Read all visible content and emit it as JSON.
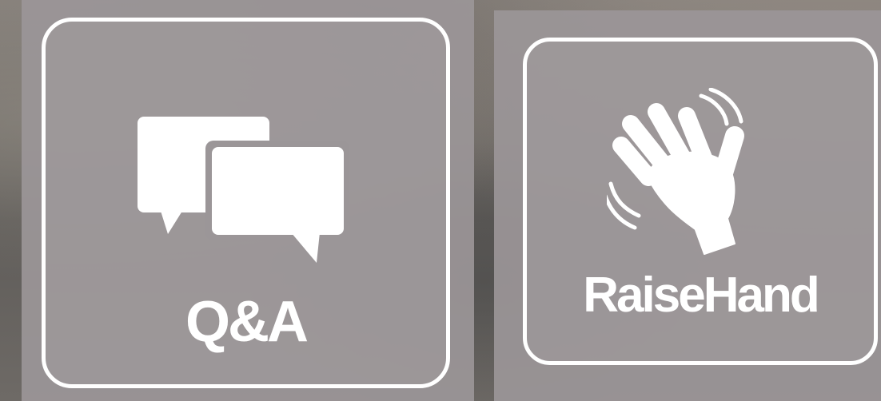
{
  "buttons": {
    "qa": {
      "label": "Q&A",
      "icon": "chat-bubbles-icon"
    },
    "raise_hand": {
      "label": "RaiseHand",
      "icon": "waving-hand-icon"
    }
  },
  "colors": {
    "panel": "#9b9698",
    "border": "#ffffff",
    "text": "#ffffff"
  }
}
